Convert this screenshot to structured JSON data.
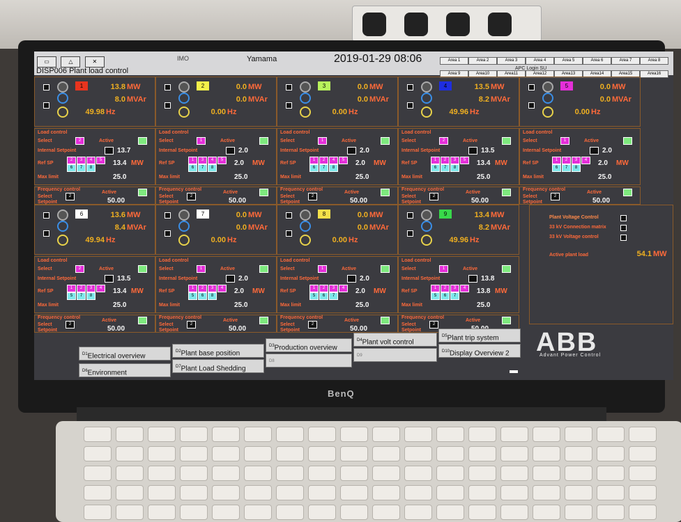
{
  "topbar": {
    "site": "Yamama",
    "datetime": "2019-01-29 08:06",
    "flag": "IMO",
    "areas": [
      "Area 1",
      "Area 2",
      "Area 3",
      "Area 4",
      "Area 5",
      "Area 6",
      "Area 7",
      "Area 8",
      "Area 9",
      "Area10",
      "Area11",
      "Area12",
      "Area13",
      "Area14",
      "Area15",
      "Area16"
    ],
    "apc_login": "APC Login",
    "apc_su": "SU"
  },
  "display_title": "DISP006  Plant load control",
  "generators": [
    {
      "id": "1",
      "color": "#e8341e",
      "mw": "13.8",
      "mvar": "8.0",
      "hz": "49.98",
      "lc_select": "2",
      "internal_sp": "13.7",
      "ref_sp": "13.4",
      "max_limit": "25.0",
      "fc_select": "2",
      "fc_setpoint": "50.00",
      "sp_digits": [
        "2",
        "3",
        "4",
        "5",
        "6",
        "7",
        "8"
      ]
    },
    {
      "id": "2",
      "color": "#f4f04a",
      "mw": "0.0",
      "mvar": "0.0",
      "hz": "0.00",
      "lc_select": "1",
      "internal_sp": "2.0",
      "ref_sp": "2.0",
      "max_limit": "25.0",
      "fc_select": "2",
      "fc_setpoint": "50.00",
      "sp_digits": [
        "1",
        "3",
        "4",
        "5",
        "6",
        "7",
        "8"
      ]
    },
    {
      "id": "3",
      "color": "#b8f25c",
      "mw": "0.0",
      "mvar": "0.0",
      "hz": "0.00",
      "lc_select": "1",
      "internal_sp": "2.0",
      "ref_sp": "2.0",
      "max_limit": "25.0",
      "fc_select": "2",
      "fc_setpoint": "50.00",
      "sp_digits": [
        "1",
        "2",
        "4",
        "5",
        "6",
        "7",
        "8"
      ]
    },
    {
      "id": "4",
      "color": "#1e2ee0",
      "mw": "13.5",
      "mvar": "8.2",
      "hz": "49.96",
      "lc_select": "2",
      "internal_sp": "13.5",
      "ref_sp": "13.4",
      "max_limit": "25.0",
      "fc_select": "2",
      "fc_setpoint": "50.00",
      "sp_digits": [
        "1",
        "2",
        "3",
        "5",
        "6",
        "7",
        "8"
      ]
    },
    {
      "id": "5",
      "color": "#e52fd9",
      "mw": "0.0",
      "mvar": "0.0",
      "hz": "0.00",
      "lc_select": "1",
      "internal_sp": "2.0",
      "ref_sp": "2.0",
      "max_limit": "25.0",
      "fc_select": "2",
      "fc_setpoint": "50.00",
      "sp_digits": [
        "1",
        "2",
        "3",
        "4",
        "6",
        "7",
        "8"
      ]
    },
    {
      "id": "6",
      "color": "#ffffff",
      "mw": "13.6",
      "mvar": "8.4",
      "hz": "49.94",
      "lc_select": "2",
      "internal_sp": "13.5",
      "ref_sp": "13.4",
      "max_limit": "25.0",
      "fc_select": "2",
      "fc_setpoint": "50.00",
      "sp_digits": [
        "1",
        "2",
        "3",
        "4",
        "5",
        "7",
        "8"
      ]
    },
    {
      "id": "7",
      "color": "#ffffff",
      "mw": "0.0",
      "mvar": "0.0",
      "hz": "0.00",
      "lc_select": "1",
      "internal_sp": "2.0",
      "ref_sp": "2.0",
      "max_limit": "25.0",
      "fc_select": "2",
      "fc_setpoint": "50.00",
      "sp_digits": [
        "1",
        "2",
        "3",
        "4",
        "5",
        "6",
        "8"
      ]
    },
    {
      "id": "8",
      "color": "#f4e04a",
      "mw": "0.0",
      "mvar": "0.0",
      "hz": "0.00",
      "lc_select": "1",
      "internal_sp": "2.0",
      "ref_sp": "2.0",
      "max_limit": "25.0",
      "fc_select": "2",
      "fc_setpoint": "50.00",
      "sp_digits": [
        "1",
        "2",
        "3",
        "4",
        "5",
        "6",
        "7"
      ]
    },
    {
      "id": "9",
      "color": "#38d84a",
      "mw": "13.4",
      "mvar": "8.2",
      "hz": "49.96",
      "lc_select": "1",
      "internal_sp": "13.8",
      "ref_sp": "13.8",
      "max_limit": "25.0",
      "fc_select": "2",
      "fc_setpoint": "50.00",
      "sp_digits": [
        "1",
        "2",
        "3",
        "4",
        "5",
        "6",
        "7"
      ]
    }
  ],
  "labels": {
    "mw": "MW",
    "mvar": "MVAr",
    "hz": "Hz",
    "load_control": "Load control",
    "select": "Select",
    "active": "Active",
    "internal_sp": "Internal Setpoint",
    "ref_sp": "Ref SP",
    "max_limit": "Max limit",
    "freq_control": "Frequency control",
    "setpoint": "Setpoint"
  },
  "plant": {
    "voltage_control": "Plant Voltage Control",
    "kv33_matrix": "33 kV Connection matrix",
    "kv33_voltage": "33 kV Voltage control",
    "active_load_label": "Active plant load",
    "active_load_value": "54.1",
    "active_load_unit": "MW"
  },
  "nav": {
    "d1": "D1",
    "electrical": "Electrical overview",
    "d2": "D2",
    "base": "Plant base position",
    "d3": "D3",
    "production": "Production overview",
    "d4": "D4",
    "volt": "Plant volt control",
    "d5": "D5",
    "trip": "Plant trip system",
    "d6": "D6",
    "environment": "Environment",
    "d7": "D7",
    "shedding": "Plant Load Shedding",
    "d8": "D8",
    "d9": "D9",
    "d10": "D10",
    "overview2": "Display Overview 2"
  },
  "branding": {
    "abb": "ABB",
    "tagline": "Advant Power Control",
    "monitor": "BenQ"
  }
}
